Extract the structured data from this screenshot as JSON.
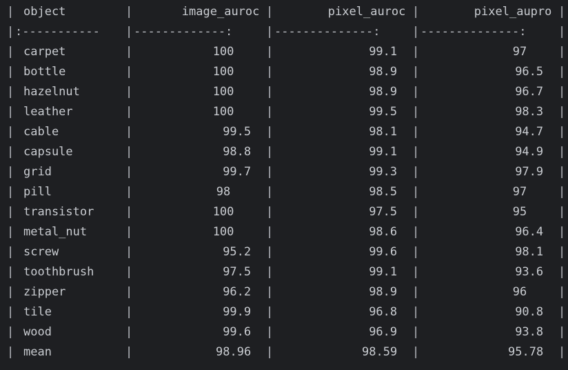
{
  "table": {
    "separator": "|",
    "header": {
      "object": "object",
      "image_auroc": "image_auroc",
      "pixel_auroc": "pixel_auroc",
      "pixel_aupro": "pixel_aupro"
    },
    "alignment_row": {
      "object": ":-----------",
      "image_auroc": "-------------:",
      "pixel_auroc": "--------------:",
      "pixel_aupro": "--------------:"
    },
    "rows": [
      {
        "object": "carpet",
        "image_auroc": "100",
        "pixel_auroc": "99.1",
        "pixel_aupro": "97"
      },
      {
        "object": "bottle",
        "image_auroc": "100",
        "pixel_auroc": "98.9",
        "pixel_aupro": "96.5"
      },
      {
        "object": "hazelnut",
        "image_auroc": "100",
        "pixel_auroc": "98.9",
        "pixel_aupro": "96.7"
      },
      {
        "object": "leather",
        "image_auroc": "100",
        "pixel_auroc": "99.5",
        "pixel_aupro": "98.3"
      },
      {
        "object": "cable",
        "image_auroc": "99.5",
        "pixel_auroc": "98.1",
        "pixel_aupro": "94.7"
      },
      {
        "object": "capsule",
        "image_auroc": "98.8",
        "pixel_auroc": "99.1",
        "pixel_aupro": "94.9"
      },
      {
        "object": "grid",
        "image_auroc": "99.7",
        "pixel_auroc": "99.3",
        "pixel_aupro": "97.9"
      },
      {
        "object": "pill",
        "image_auroc": "98",
        "pixel_auroc": "98.5",
        "pixel_aupro": "97"
      },
      {
        "object": "transistor",
        "image_auroc": "100",
        "pixel_auroc": "97.5",
        "pixel_aupro": "95"
      },
      {
        "object": "metal_nut",
        "image_auroc": "100",
        "pixel_auroc": "98.6",
        "pixel_aupro": "96.4"
      },
      {
        "object": "screw",
        "image_auroc": "95.2",
        "pixel_auroc": "99.6",
        "pixel_aupro": "98.1"
      },
      {
        "object": "toothbrush",
        "image_auroc": "97.5",
        "pixel_auroc": "99.1",
        "pixel_aupro": "93.6"
      },
      {
        "object": "zipper",
        "image_auroc": "96.2",
        "pixel_auroc": "98.9",
        "pixel_aupro": "96"
      },
      {
        "object": "tile",
        "image_auroc": "99.9",
        "pixel_auroc": "96.8",
        "pixel_aupro": "90.8"
      },
      {
        "object": "wood",
        "image_auroc": "99.6",
        "pixel_auroc": "96.9",
        "pixel_aupro": "93.8"
      },
      {
        "object": "mean",
        "image_auroc": "98.96",
        "pixel_auroc": "98.59",
        "pixel_aupro": "95.78"
      }
    ]
  },
  "colors": {
    "background": "#1e1f22",
    "text": "#c9ccd1",
    "separator": "#bcbec4"
  }
}
